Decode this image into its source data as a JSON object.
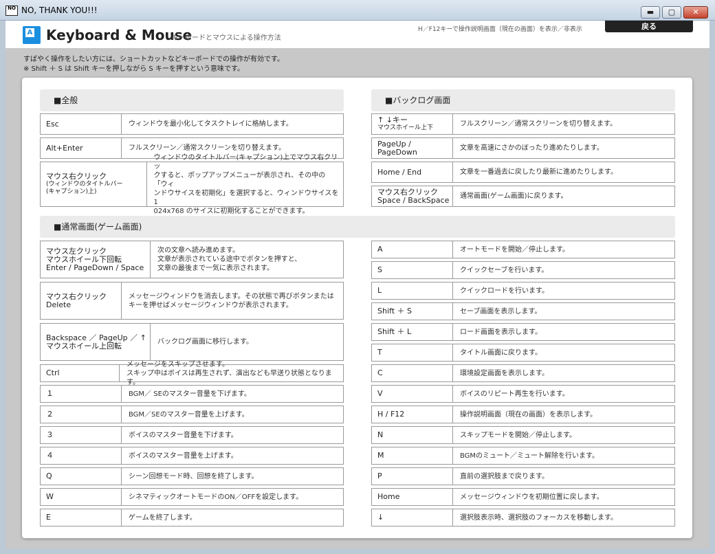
{
  "window": {
    "title": "NO, THANK YOU!!!",
    "icon_text": "NO",
    "minimize": "▬",
    "maximize": "▢",
    "close": "✕"
  },
  "header": {
    "logo_letter": "A",
    "title": "Keyboard & Mouse",
    "subtitle": "キーボードとマウスによる操作方法",
    "hint": "H／F12キーで操作説明画面（現在の画面）を表示／非表示",
    "back_label": "戻る"
  },
  "intro": {
    "line1": "すばやく操作をしたい方には、ショートカットなどキーボードでの操作が有効です。",
    "line2": "※ Shift ＋ S は Shift キーを押しながら S キーを押すという意味です。"
  },
  "sections": {
    "general": "■全般",
    "backlog": "■バックログ画面",
    "normal": "■通常画面(ゲーム画面)"
  },
  "general_rows": [
    {
      "key": "Esc",
      "desc": "ウィンドウを最小化してタスクトレイに格納します。"
    },
    {
      "key": "Alt+Enter",
      "desc": "フルスクリーン／通常スクリーンを切り替えます。"
    },
    {
      "key": "マウス右クリック",
      "key_sub1": "(ウィンドウのタイトルバー",
      "key_sub2": "(キャプション)上)",
      "desc1": "ウィンドウのタイトルバー(キャプション)上でマウス右クリッ",
      "desc2": "クすると、ポップアップメニューが表示され、その中の「ウィ",
      "desc3": "ンドウサイスを初期化」を選択すると、ウィンドウサイスを1",
      "desc4": "024x768 のサイスに初期化することができます。"
    }
  ],
  "backlog_rows": [
    {
      "key": "↑ ↓キー",
      "key_sub": "マウスホイール上下",
      "desc": "フルスクリーン／通常スクリーンを切り替えます。"
    },
    {
      "key": "PageUp /",
      "key2": "PageDown",
      "desc": "文章を高速にさかのぼったり進めたりします。"
    },
    {
      "key": "Home / End",
      "desc": "文章を一番過去に戻したり最新に進めたりします。"
    },
    {
      "key": "マウス右クリック",
      "key2": "Space / BackSpace",
      "desc": "通常画面(ゲーム画面)に戻ります。"
    }
  ],
  "normal_left": [
    {
      "key": "マウス左クリック",
      "key2": "マウスホイール下回転",
      "key3": "Enter / PageDown / Space",
      "desc1": "次の文章へ読み進めます。",
      "desc2": "文章が表示されている途中でボタンを押すと、",
      "desc3": "文章の最後まで一気に表示されます。"
    },
    {
      "key": "マウス右クリック",
      "key2": "Delete",
      "desc1": "メッセージウィンドウを消去します。その状態で再びボタンまたは",
      "desc2": "キーを押せばメッセージウィンドウが表示されます。"
    },
    {
      "key": "Backspace ／ PageUp ／ ↑",
      "key2": "マウスホイール上回転",
      "desc": "バックログ画面に移行します。"
    },
    {
      "key": "Ctrl",
      "desc1": "メッセージをスキップさせます。",
      "desc2": "スキップ中はボイスは再生されず、演出なども早送り状態となります。"
    },
    {
      "key": "１",
      "desc": "BGM／ SEのマスター音量を下げます。"
    },
    {
      "key": "２",
      "desc": "BGM／SEのマスター音量を上げます。"
    },
    {
      "key": "３",
      "desc": "ボイスのマスター音量を下げます。"
    },
    {
      "key": "４",
      "desc": "ボイスのマスター音量を上げます。"
    },
    {
      "key": "Q",
      "desc": "シーン回想モード時、回想を終了します。"
    },
    {
      "key": "W",
      "desc": "シネマティックオートモードのON／OFFを設定します。"
    },
    {
      "key": "E",
      "desc": "ゲームを終了します。"
    }
  ],
  "normal_right": [
    {
      "key": "A",
      "desc": "オートモードを開始／停止します。"
    },
    {
      "key": "S",
      "desc": "クイックセーブを行います。"
    },
    {
      "key": "L",
      "desc": "クイックロードを行います。"
    },
    {
      "key": "Shift ＋ S",
      "desc": "セーブ画面を表示します。"
    },
    {
      "key": "Shift ＋ L",
      "desc": "ロード画面を表示します。"
    },
    {
      "key": "T",
      "desc": "タイトル画面に戻ります。"
    },
    {
      "key": "C",
      "desc": "環境設定画面を表示します。"
    },
    {
      "key": "V",
      "desc": "ボイスのリピート再生を行います。"
    },
    {
      "key": "H / F12",
      "desc": "操作説明画面（現在の画面）を表示します。"
    },
    {
      "key": "N",
      "desc": "スキップモードを開始／停止します。"
    },
    {
      "key": "M",
      "desc": "BGMのミュート／ミュート解除を行います。"
    },
    {
      "key": "P",
      "desc": "直前の選択肢まで戻ります。"
    },
    {
      "key": "Home",
      "desc": "メッセージウィンドウを初期位置に戻します。"
    },
    {
      "key": "↓",
      "desc": "選択肢表示時、選択肢のフォーカスを移動します。"
    }
  ]
}
